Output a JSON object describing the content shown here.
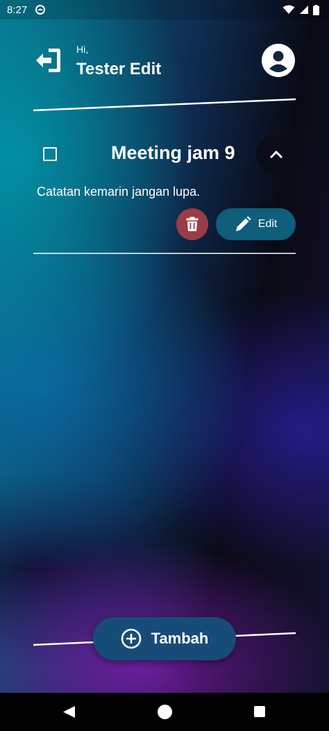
{
  "status_bar": {
    "time": "8:27",
    "app_icon": "android-app-icon",
    "icons": [
      "wifi-icon",
      "signal-icon",
      "battery-icon"
    ]
  },
  "header": {
    "greeting": "Hi,",
    "user_name": "Tester Edit",
    "logout_icon": "logout-icon",
    "avatar_icon": "account-circle-icon"
  },
  "note_card": {
    "title": "Meeting jam 9",
    "checked": false,
    "expanded": true,
    "description": "Catatan kemarin jangan lupa.",
    "delete_icon": "trash-icon",
    "edit_label": "Edit",
    "edit_icon": "pencil-icon",
    "colors": {
      "delete_bg": "#9a3b47",
      "edit_bg": "#0f5e7a"
    }
  },
  "footer": {
    "add_label": "Tambah",
    "add_icon": "plus-circle-icon",
    "add_bg": "#184c78"
  },
  "nav_bar": {
    "icons": [
      "back-icon",
      "home-icon",
      "recents-icon"
    ]
  }
}
